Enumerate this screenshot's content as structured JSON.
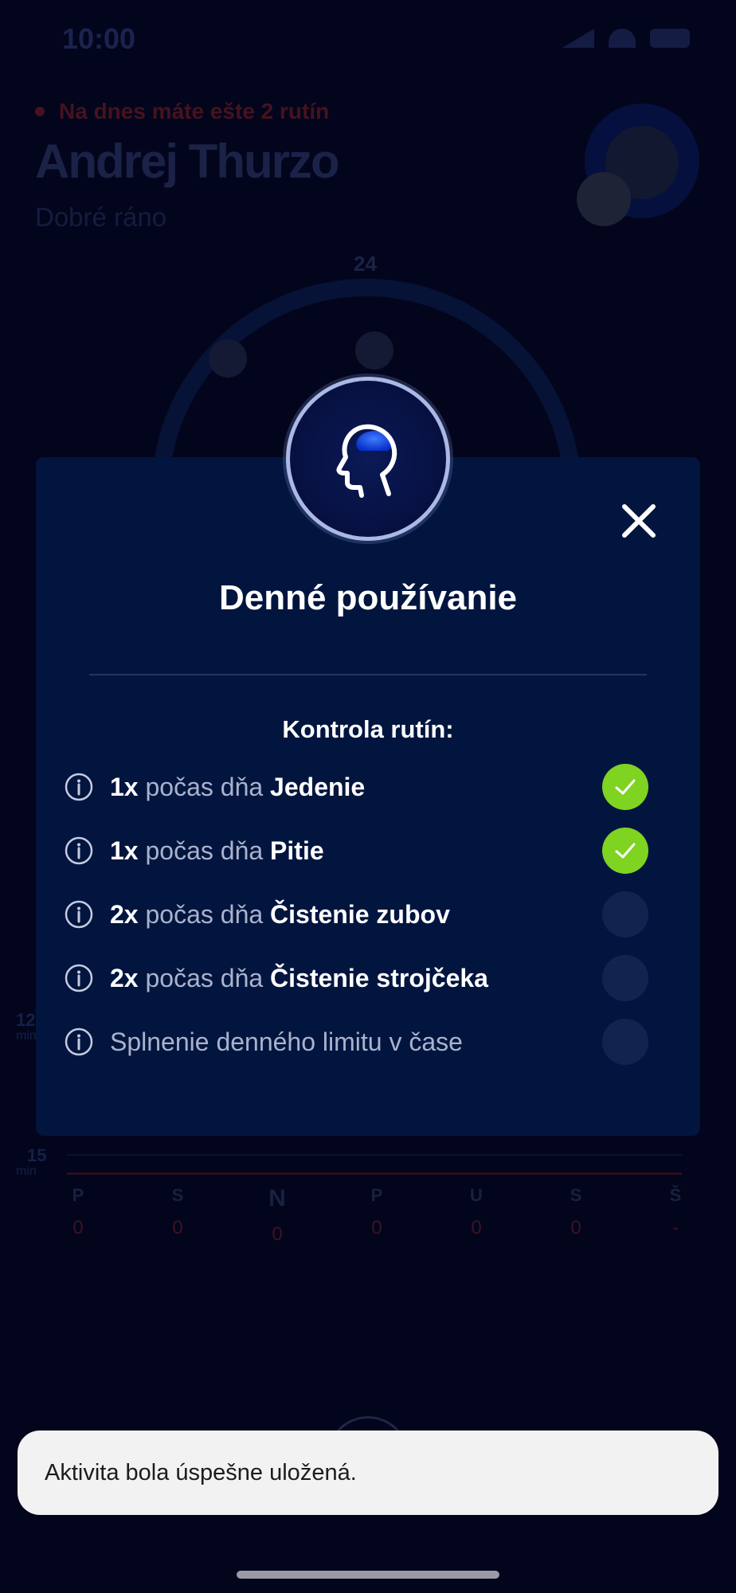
{
  "status_bar": {
    "time": "10:00"
  },
  "header": {
    "reminder": "Na dnes máte ešte 2 rutín",
    "user_name": "Andrej Thurzo",
    "greeting": "Dobré ráno"
  },
  "chart_bg": {
    "top_hour": "24",
    "y_labels": [
      {
        "value": "12",
        "unit": "min"
      },
      {
        "value": "15",
        "unit": "min"
      }
    ],
    "days": [
      {
        "label": "P",
        "value": "0"
      },
      {
        "label": "S",
        "value": "0"
      },
      {
        "label": "N",
        "value": "0"
      },
      {
        "label": "P",
        "value": "0"
      },
      {
        "label": "U",
        "value": "0"
      },
      {
        "label": "S",
        "value": "0"
      },
      {
        "label": "Š",
        "value": "-"
      }
    ]
  },
  "modal": {
    "icon": "head-brain-icon",
    "close_icon": "close-icon",
    "title": "Denné používanie",
    "section_title": "Kontrola rutín:",
    "routines": [
      {
        "count": "1x",
        "middle": "počas dňa",
        "name": "Jedenie",
        "done": true
      },
      {
        "count": "1x",
        "middle": "počas dňa",
        "name": "Pitie",
        "done": true
      },
      {
        "count": "2x",
        "middle": "počas dňa",
        "name": "Čistenie zubov",
        "done": false
      },
      {
        "count": "2x",
        "middle": "počas dňa",
        "name": "Čistenie strojčeka",
        "done": false
      },
      {
        "count": "",
        "middle": "Splnenie denného limitu v čase",
        "name": "",
        "done": false
      }
    ]
  },
  "toast": {
    "message": "Aktivita bola úspešne uložená."
  },
  "colors": {
    "check_done": "#7fd321",
    "modal_bg": "#02153f",
    "page_bg": "#03051c"
  }
}
